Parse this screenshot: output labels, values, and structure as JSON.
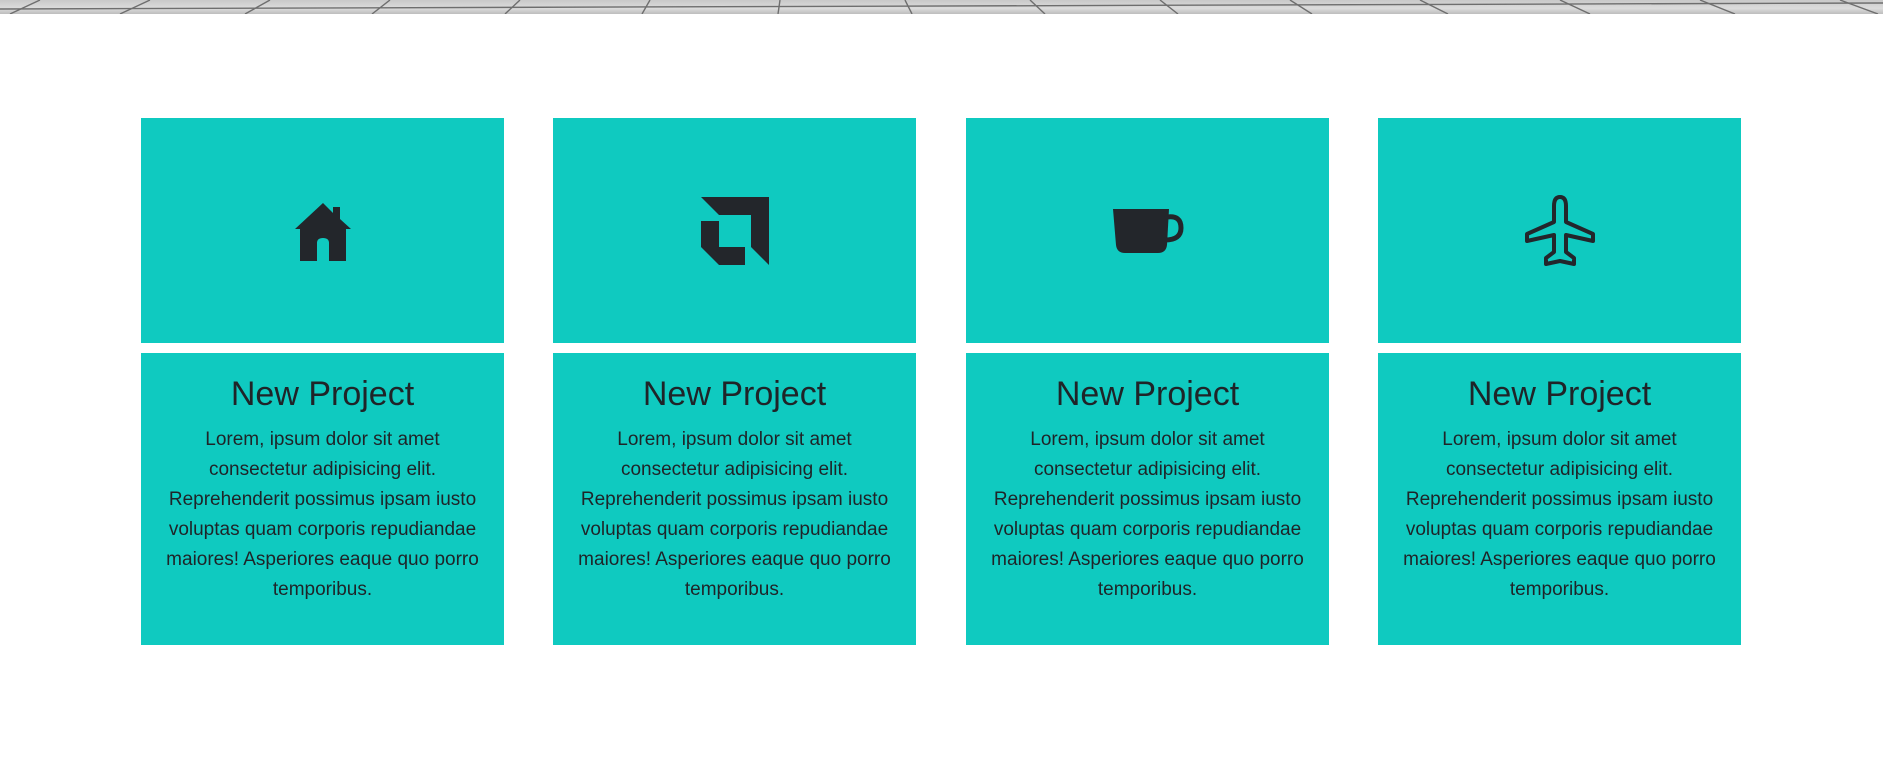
{
  "header": {
    "image": "tiled-floor-photo"
  },
  "colors": {
    "card_background": "#0fcac0",
    "icon_color": "#23262b",
    "text_color": "#1f2428",
    "page_background": "#ffffff"
  },
  "cards": [
    {
      "icon": "house-icon",
      "title": "New Project",
      "text": "Lorem, ipsum dolor sit amet consectetur adipisicing elit. Reprehenderit possimus ipsam iusto voluptas quam corporis repudiandae maiores! Asperiores eaque quo porro temporibus."
    },
    {
      "icon": "amd-logo-icon",
      "title": "New Project",
      "text": "Lorem, ipsum dolor sit amet consectetur adipisicing elit. Reprehenderit possimus ipsam iusto voluptas quam corporis repudiandae maiores! Asperiores eaque quo porro temporibus."
    },
    {
      "icon": "coffee-cup-icon",
      "title": "New Project",
      "text": "Lorem, ipsum dolor sit amet consectetur adipisicing elit. Reprehenderit possimus ipsam iusto voluptas quam corporis repudiandae maiores! Asperiores eaque quo porro temporibus."
    },
    {
      "icon": "airplane-icon",
      "title": "New Project",
      "text": "Lorem, ipsum dolor sit amet consectetur adipisicing elit. Reprehenderit possimus ipsam iusto voluptas quam corporis repudiandae maiores! Asperiores eaque quo porro temporibus."
    }
  ]
}
